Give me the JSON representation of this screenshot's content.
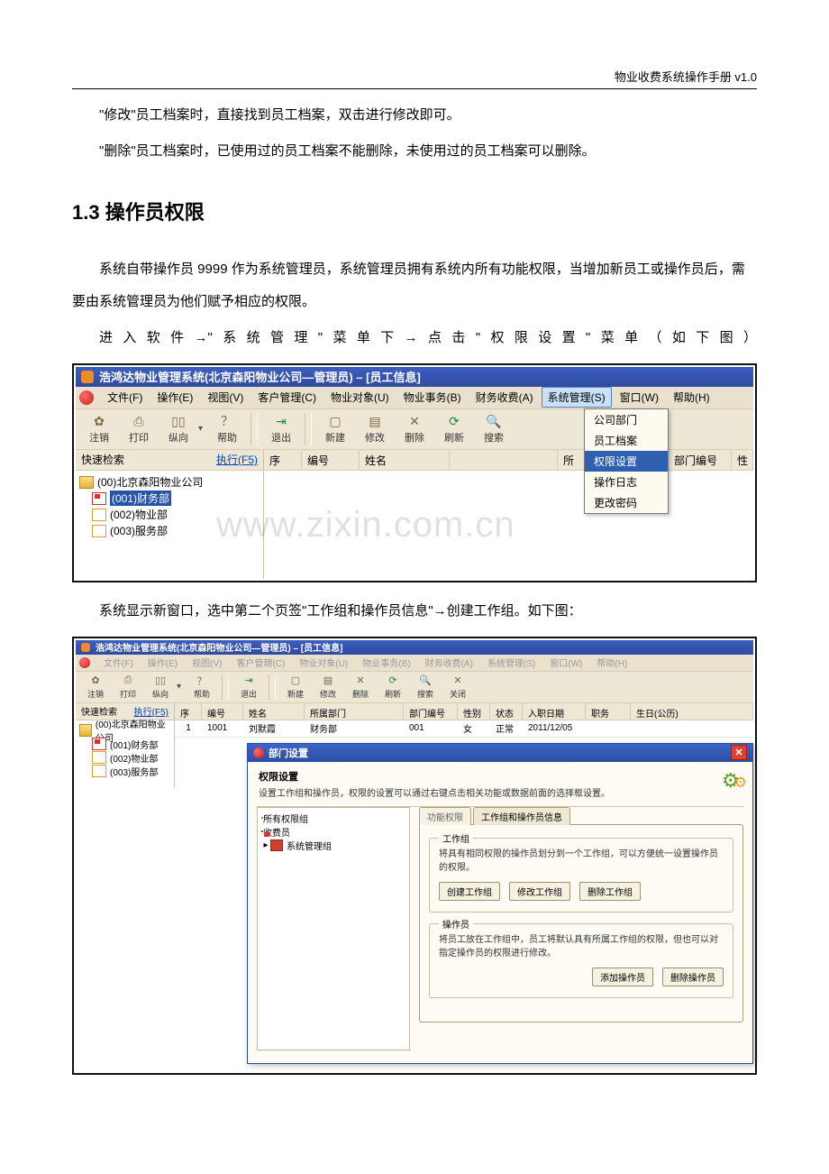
{
  "doc": {
    "header": "物业收费系统操作手册 v1.0",
    "p1": "\"修改\"员工档案时，直接找到员工档案，双击进行修改即可。",
    "p2": "\"删除\"员工档案时，已使用过的员工档案不能删除，未使用过的员工档案可以删除。",
    "h2": "1.3 操作员权限",
    "p3": "系统自带操作员 9999 作为系统管理员，系统管理员拥有系统内所有功能权限，当增加新员工或操作员后，需要由系统管理员为他们赋予相应的权限。",
    "p4": "进入软件→\"系统管理\"菜单下→点击\"权限设置\"菜单（如下图）",
    "p5": "系统显示新窗口，选中第二个页签\"工作组和操作员信息\"→创建工作组。如下图："
  },
  "watermark": "www.zixin.com.cn",
  "app1": {
    "title": "浩鸿达物业管理系统(北京森阳物业公司—管理员)  –  [员工信息]",
    "menu": {
      "file": "文件(F)",
      "ops": "操作(E)",
      "view": "视图(V)",
      "cust": "客户管理(C)",
      "obj": "物业对象(U)",
      "affair": "物业事务(B)",
      "finance": "财务收费(A)",
      "sys": "系统管理(S)",
      "window": "窗口(W)",
      "help": "帮助(H)"
    },
    "toolbar": {
      "logout": "注销",
      "print": "打印",
      "orient": "纵向",
      "helper": "帮助",
      "exit": "退出",
      "new": "新建",
      "edit": "修改",
      "del": "删除",
      "refresh": "刷新",
      "search": "搜索"
    },
    "quicksearch": {
      "label": "快速检索",
      "run": "执行(F5)"
    },
    "tree": {
      "root": "(00)北京森阳物业公司",
      "c1": "(001)财务部",
      "c2": "(002)物业部",
      "c3": "(003)服务部"
    },
    "grid": {
      "seq": "序",
      "code": "编号",
      "name": "姓名",
      "dept": "所",
      "deptcode": "部门编号",
      "sex": "性"
    },
    "dropdown": {
      "i1": "公司部门",
      "i2": "员工档案",
      "i3": "权限设置",
      "i4": "操作日志",
      "i5": "更改密码"
    }
  },
  "app2": {
    "title": "浩鸿达物业管理系统(北京森阳物业公司—管理员)  –  [员工信息]",
    "menu": {
      "file": "文件(F)",
      "ops": "操作(E)",
      "view": "视图(V)",
      "cust": "客户管理(C)",
      "obj": "物业对象(U)",
      "affair": "物业事务(B)",
      "finance": "财务收费(A)",
      "sys": "系统管理(S)",
      "window": "窗口(W)",
      "help": "帮助(H)"
    },
    "toolbar": {
      "logout": "注销",
      "print": "打印",
      "orient": "纵向",
      "helper": "帮助",
      "exit": "退出",
      "new": "新建",
      "edit": "修改",
      "del": "删除",
      "refresh": "刷新",
      "search": "搜索",
      "close": "关闭"
    },
    "quicksearch": {
      "label": "快速检索",
      "run": "执行(F5)"
    },
    "tree": {
      "root": "(00)北京森阳物业公司",
      "c1": "(001)财务部",
      "c2": "(002)物业部",
      "c3": "(003)服务部"
    },
    "grid": {
      "seq": "序",
      "code": "编号",
      "name": "姓名",
      "dept": "所属部门",
      "deptcode": "部门编号",
      "sex": "性别",
      "status": "状态",
      "hiredate": "入职日期",
      "job": "职务",
      "birth": "生日(公历)"
    },
    "row": {
      "seq": "1",
      "code": "1001",
      "name": "刘默霞",
      "dept": "财务部",
      "deptcode": "001",
      "sex": "女",
      "status": "正常",
      "hiredate": "2011/12/05"
    },
    "dlg": {
      "title": "部门设置",
      "subtitle": "权限设置",
      "desc": "设置工作组和操作员，权限的设置可以通过右键点击相关功能或数据前面的选择框设置。",
      "tree": {
        "root": "所有权限组",
        "c1": "收费员",
        "c2": "系统管理组"
      },
      "tab1": "功能权限",
      "tab2": "工作组和操作员信息",
      "fs1": {
        "legend": "工作组",
        "txt": "将具有相同权限的操作员划分到一个工作组，可以方便统一设置操作员的权限。",
        "b1": "创建工作组",
        "b2": "修改工作组",
        "b3": "删除工作组"
      },
      "fs2": {
        "legend": "操作员",
        "txt": "将员工放在工作组中，员工将默认具有所属工作组的权限，但也可以对指定操作员的权限进行修改。",
        "b1": "添加操作员",
        "b2": "删除操作员"
      }
    }
  }
}
